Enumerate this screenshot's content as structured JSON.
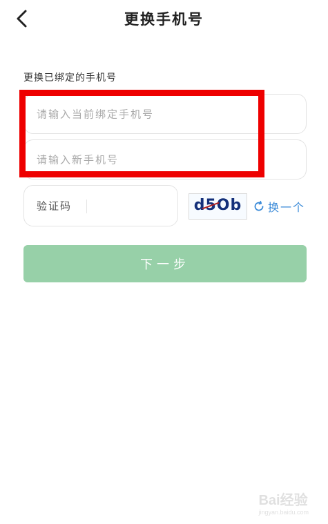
{
  "header": {
    "title": "更换手机号",
    "back_icon": "chevron-left-icon"
  },
  "form": {
    "section_label": "更换已绑定的手机号",
    "current_phone_placeholder": "请输入当前绑定手机号",
    "new_phone_placeholder": "请输入新手机号",
    "code_placeholder": "验证码",
    "captcha_text": "d5Ob",
    "refresh_label": "换一个",
    "refresh_icon": "refresh-icon",
    "next_label": "下一步"
  },
  "watermark": {
    "main": "Bai经验",
    "sub": "jingyan.baidu.com"
  },
  "colors": {
    "highlight": "#ee0000",
    "next_button": "#97d0a8",
    "link": "#3a8ad8"
  }
}
